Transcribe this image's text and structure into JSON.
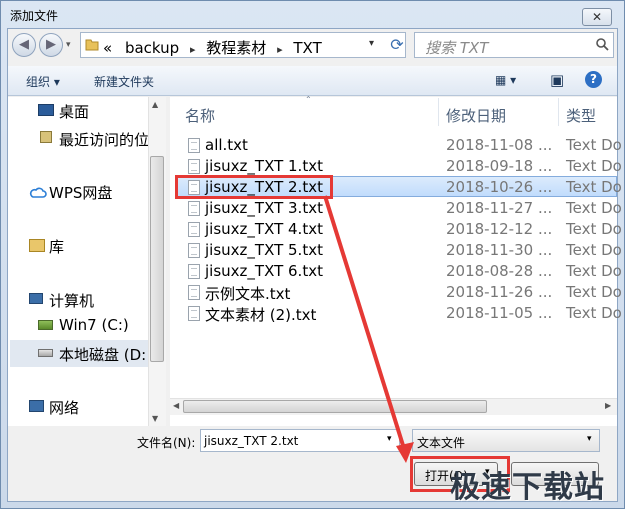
{
  "window": {
    "title": "添加文件",
    "close_glyph": "✕"
  },
  "nav": {
    "back_glyph": "◀",
    "forward_glyph": "▶"
  },
  "address": {
    "overflow": "«",
    "crumbs": [
      "backup",
      "教程素材",
      "TXT"
    ],
    "separator": "▸",
    "dropdown_glyph": "▾",
    "refresh_glyph": "⟳"
  },
  "search": {
    "placeholder": "搜索 TXT",
    "icon": "search-icon"
  },
  "toolbar": {
    "organize": "组织 ▾",
    "new_folder": "新建文件夹",
    "view_glyph": "▦ ▾",
    "preview_glyph": "▣",
    "help_glyph": "?"
  },
  "sidebar": {
    "items": [
      {
        "label": "桌面",
        "icon": "desktop-icon"
      },
      {
        "label": "最近访问的位",
        "icon": "recent-places-icon"
      },
      {
        "label": "WPS网盘",
        "icon": "cloud-icon"
      },
      {
        "label": "库",
        "icon": "library-icon"
      },
      {
        "label": "计算机",
        "icon": "computer-icon"
      },
      {
        "label": "Win7 (C:)",
        "icon": "drive-icon"
      },
      {
        "label": "本地磁盘 (D:",
        "icon": "drive-icon"
      },
      {
        "label": "网络",
        "icon": "network-icon"
      }
    ]
  },
  "columns": {
    "name": "名称",
    "date": "修改日期",
    "type": "类型"
  },
  "files": [
    {
      "name": "all.txt",
      "date": "2018-11-08 ...",
      "type": "Text Do"
    },
    {
      "name": "jisuxz_TXT 1.txt",
      "date": "2018-09-18 ...",
      "type": "Text Do"
    },
    {
      "name": "jisuxz_TXT 2.txt",
      "date": "2018-10-26 ...",
      "type": "Text Do"
    },
    {
      "name": "jisuxz_TXT 3.txt",
      "date": "2018-11-27 ...",
      "type": "Text Do"
    },
    {
      "name": "jisuxz_TXT 4.txt",
      "date": "2018-12-12 ...",
      "type": "Text Do"
    },
    {
      "name": "jisuxz_TXT 5.txt",
      "date": "2018-11-30 ...",
      "type": "Text Do"
    },
    {
      "name": "jisuxz_TXT 6.txt",
      "date": "2018-08-28 ...",
      "type": "Text Do"
    },
    {
      "name": "示例文本.txt",
      "date": "2018-11-26 ...",
      "type": "Text Do"
    },
    {
      "name": "文本素材 (2).txt",
      "date": "2018-11-05 ...",
      "type": "Text Do"
    }
  ],
  "selected_file": "jisuxz_TXT 2.txt",
  "footer": {
    "filename_label": "文件名(N):",
    "filename_value": "jisuxz_TXT 2.txt",
    "filetype_value": "文本文件",
    "open_label": "打开(O)",
    "dropdown_glyph": "▾"
  },
  "watermark": "极速下载站",
  "colors": {
    "highlight": "#e53935",
    "selection": "#c1dcfc"
  }
}
